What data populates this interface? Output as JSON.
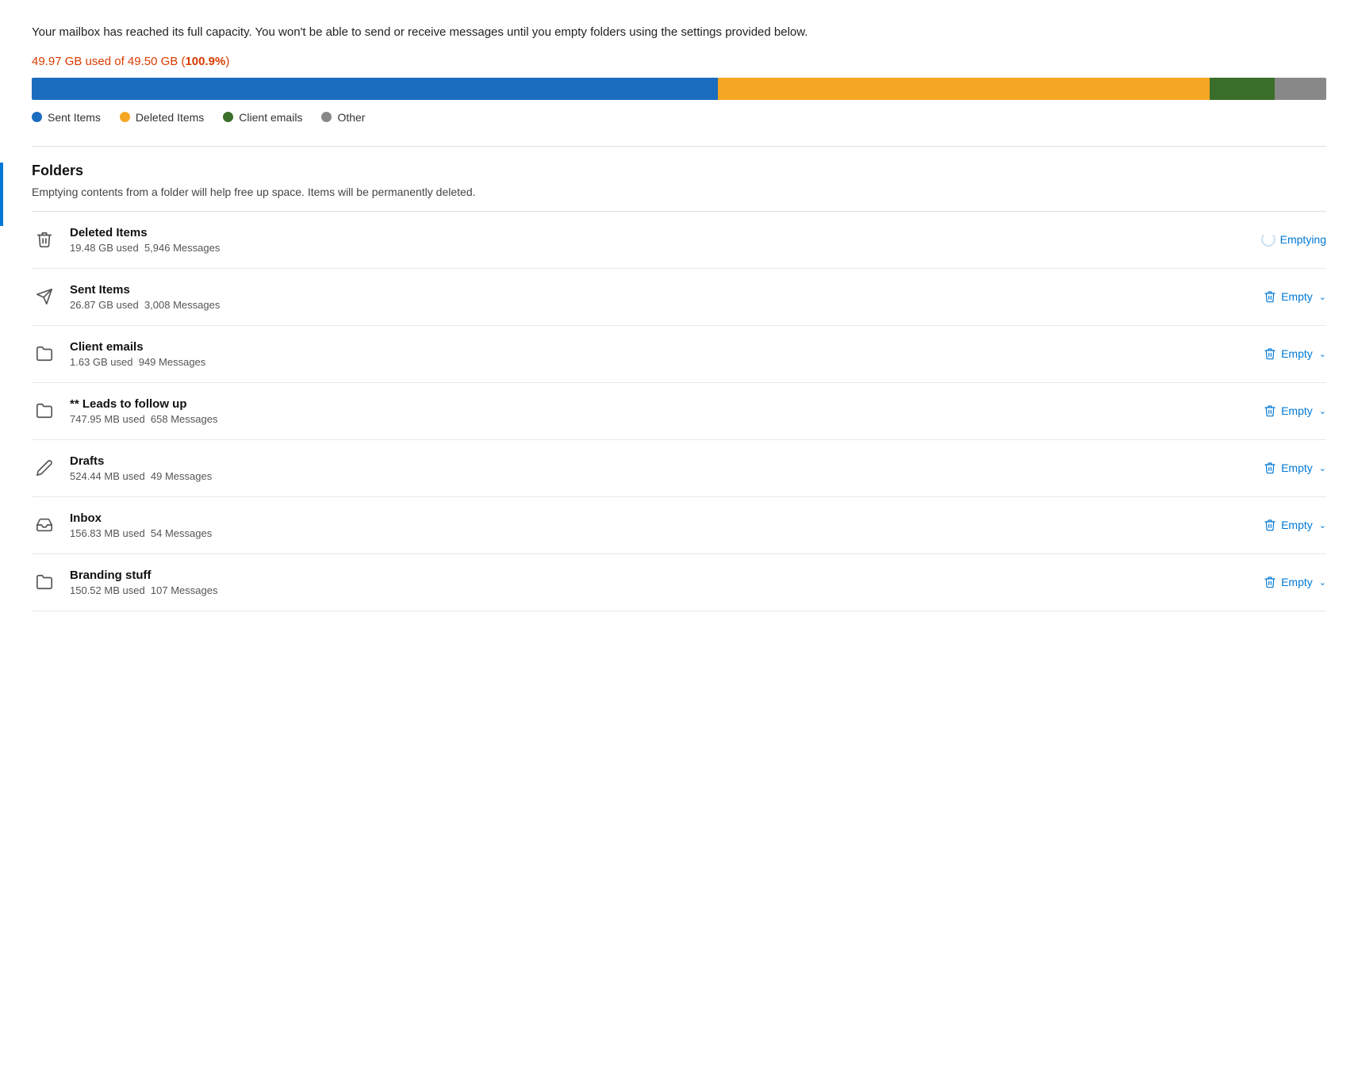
{
  "warning": {
    "text": "Your mailbox has reached its full capacity. You won't be able to send or receive messages until you empty folders using the settings provided below."
  },
  "usage": {
    "label": "49.97 GB used of 49.50 GB (",
    "percent": "100.9%",
    "suffix": ")"
  },
  "progressBar": {
    "segments": [
      {
        "label": "Sent Items",
        "color": "#1a6dbe",
        "width": 53
      },
      {
        "label": "Deleted Items",
        "color": "#f5a623",
        "width": 38
      },
      {
        "label": "Client emails",
        "color": "#3a6e2a",
        "width": 5
      },
      {
        "label": "Other",
        "color": "#888",
        "width": 4
      }
    ]
  },
  "legend": {
    "items": [
      {
        "label": "Sent Items",
        "color": "#1a6dbe"
      },
      {
        "label": "Deleted Items",
        "color": "#f5a623"
      },
      {
        "label": "Client emails",
        "color": "#3a6e2a"
      },
      {
        "label": "Other",
        "color": "#888"
      }
    ]
  },
  "folders": {
    "title": "Folders",
    "description": "Emptying contents from a folder will help free up space. Items will be permanently deleted.",
    "items": [
      {
        "name": "Deleted Items",
        "meta": "19.48 GB used  5,946 Messages",
        "icon": "trash",
        "action": "Emptying",
        "actionState": "emptying"
      },
      {
        "name": "Sent Items",
        "meta": "26.87 GB used  3,008 Messages",
        "icon": "send",
        "action": "Empty",
        "actionState": "empty"
      },
      {
        "name": "Client emails",
        "meta": "1.63 GB used  949 Messages",
        "icon": "folder",
        "action": "Empty",
        "actionState": "empty"
      },
      {
        "name": "** Leads to follow up",
        "meta": "747.95 MB used  658 Messages",
        "icon": "folder",
        "action": "Empty",
        "actionState": "empty"
      },
      {
        "name": "Drafts",
        "meta": "524.44 MB used  49 Messages",
        "icon": "pencil",
        "action": "Empty",
        "actionState": "empty"
      },
      {
        "name": "Inbox",
        "meta": "156.83 MB used  54 Messages",
        "icon": "inbox",
        "action": "Empty",
        "actionState": "empty"
      },
      {
        "name": "Branding stuff",
        "meta": "150.52 MB used  107 Messages",
        "icon": "folder",
        "action": "Empty",
        "actionState": "empty"
      }
    ]
  },
  "icons": {
    "trash": "🗑",
    "send": "➤",
    "folder": "📁",
    "pencil": "✏",
    "inbox": "📥"
  }
}
